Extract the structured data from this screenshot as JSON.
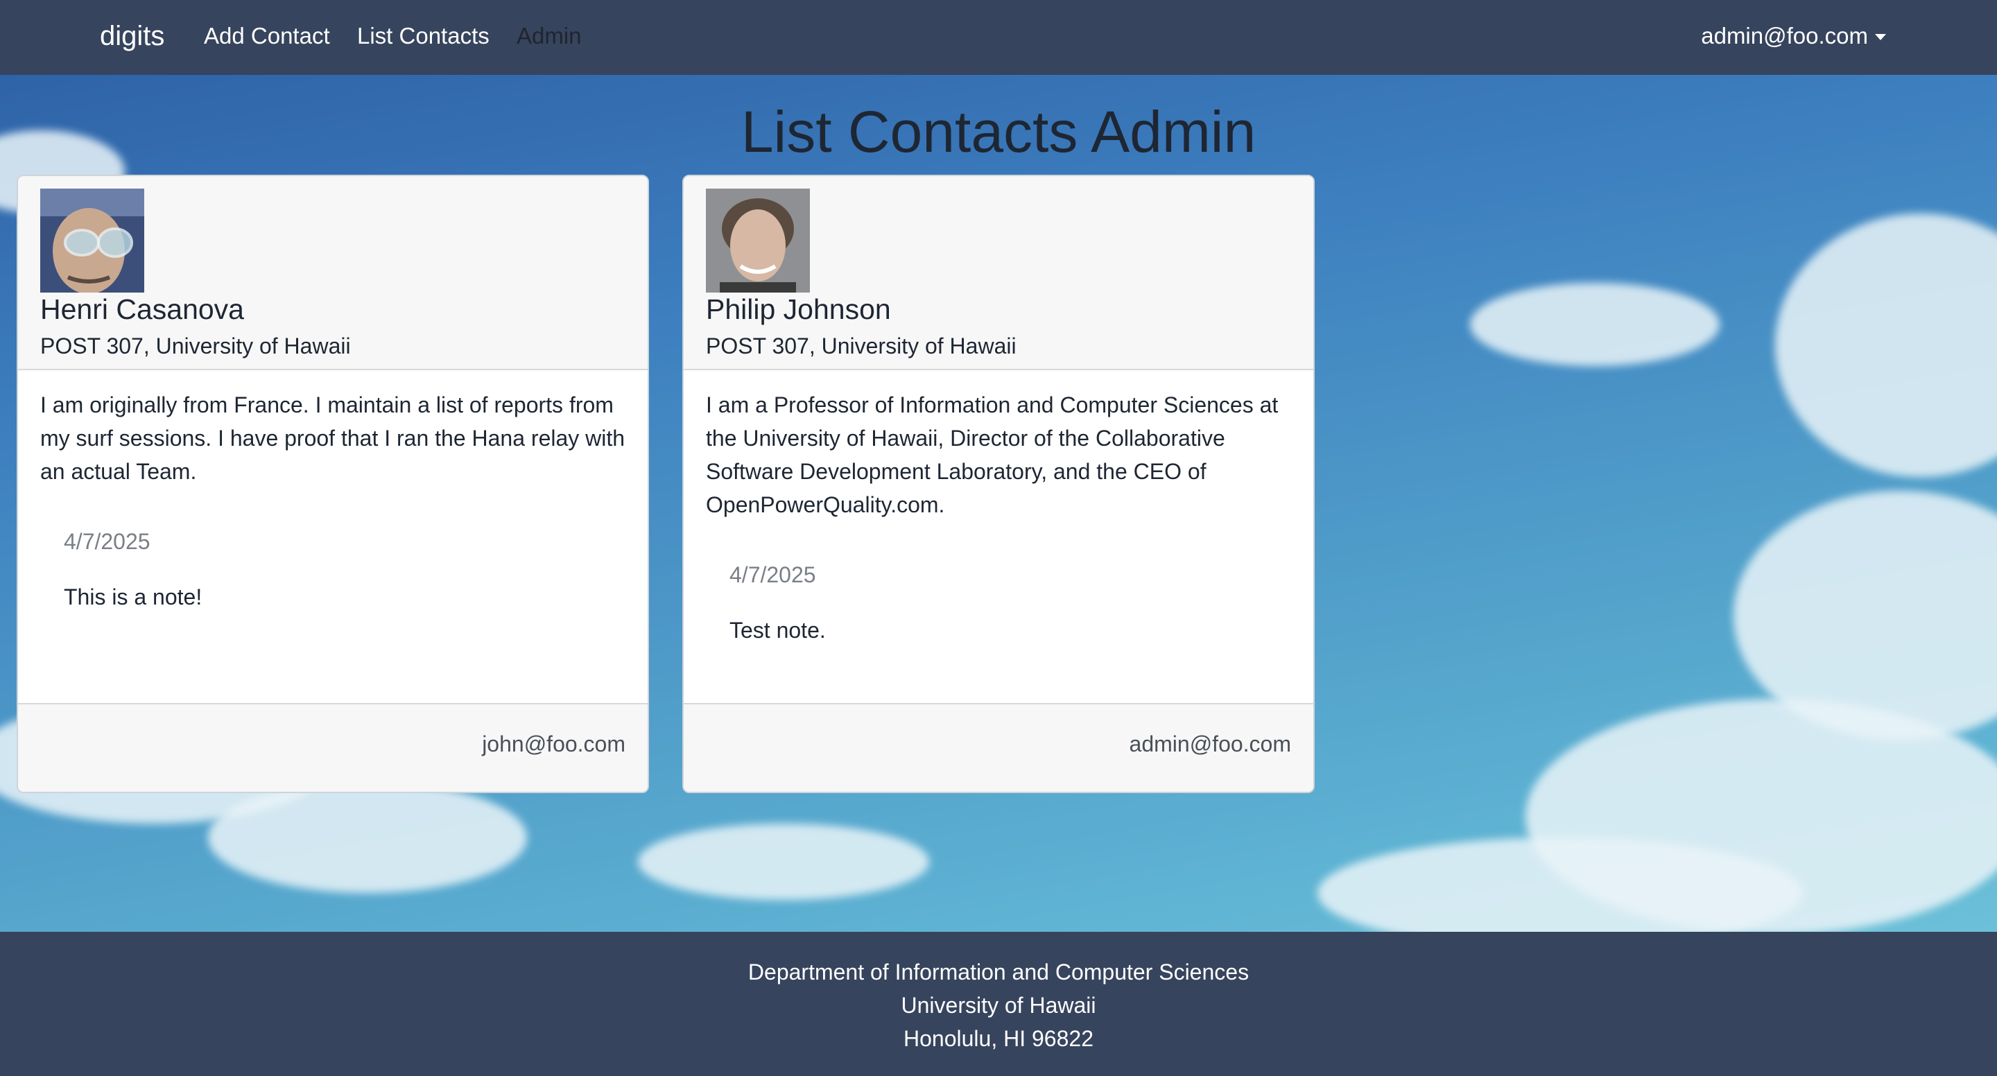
{
  "navbar": {
    "brand": "digits",
    "links": [
      {
        "label": "Add Contact"
      },
      {
        "label": "List Contacts"
      },
      {
        "label": "Admin"
      }
    ],
    "user": "admin@foo.com"
  },
  "page": {
    "title": "List Contacts Admin"
  },
  "contacts": [
    {
      "name": "Henri Casanova",
      "address": "POST 307, University of Hawaii",
      "description": "I am originally from France. I maintain a list of reports from my surf sessions. I have proof that I ran the Hana relay with an actual Team.",
      "notes": [
        {
          "date": "4/7/2025",
          "text": "This is a note!"
        }
      ],
      "owner": "john@foo.com"
    },
    {
      "name": "Philip Johnson",
      "address": "POST 307, University of Hawaii",
      "description": "I am a Professor of Information and Computer Sciences at the University of Hawaii, Director of the Collaborative Software Development Laboratory, and the CEO of OpenPowerQuality.com.",
      "notes": [
        {
          "date": "4/7/2025",
          "text": "Test note."
        }
      ],
      "owner": "admin@foo.com"
    }
  ],
  "footer": {
    "lines": [
      "Department of Information and Computer Sciences",
      "University of Hawaii",
      "Honolulu, HI 96822"
    ]
  }
}
